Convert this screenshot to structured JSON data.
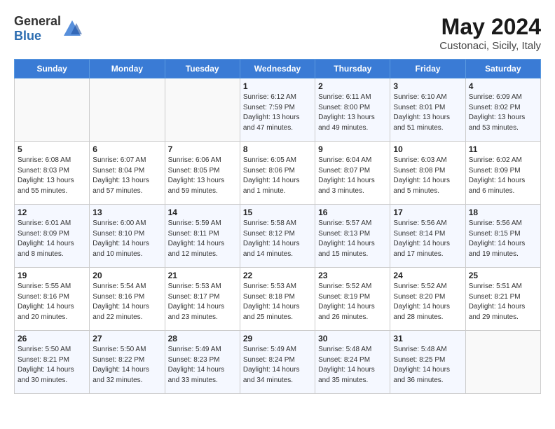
{
  "header": {
    "logo_general": "General",
    "logo_blue": "Blue",
    "month_year": "May 2024",
    "location": "Custonaci, Sicily, Italy"
  },
  "weekdays": [
    "Sunday",
    "Monday",
    "Tuesday",
    "Wednesday",
    "Thursday",
    "Friday",
    "Saturday"
  ],
  "weeks": [
    [
      {
        "day": "",
        "info": ""
      },
      {
        "day": "",
        "info": ""
      },
      {
        "day": "",
        "info": ""
      },
      {
        "day": "1",
        "info": "Sunrise: 6:12 AM\nSunset: 7:59 PM\nDaylight: 13 hours\nand 47 minutes."
      },
      {
        "day": "2",
        "info": "Sunrise: 6:11 AM\nSunset: 8:00 PM\nDaylight: 13 hours\nand 49 minutes."
      },
      {
        "day": "3",
        "info": "Sunrise: 6:10 AM\nSunset: 8:01 PM\nDaylight: 13 hours\nand 51 minutes."
      },
      {
        "day": "4",
        "info": "Sunrise: 6:09 AM\nSunset: 8:02 PM\nDaylight: 13 hours\nand 53 minutes."
      }
    ],
    [
      {
        "day": "5",
        "info": "Sunrise: 6:08 AM\nSunset: 8:03 PM\nDaylight: 13 hours\nand 55 minutes."
      },
      {
        "day": "6",
        "info": "Sunrise: 6:07 AM\nSunset: 8:04 PM\nDaylight: 13 hours\nand 57 minutes."
      },
      {
        "day": "7",
        "info": "Sunrise: 6:06 AM\nSunset: 8:05 PM\nDaylight: 13 hours\nand 59 minutes."
      },
      {
        "day": "8",
        "info": "Sunrise: 6:05 AM\nSunset: 8:06 PM\nDaylight: 14 hours\nand 1 minute."
      },
      {
        "day": "9",
        "info": "Sunrise: 6:04 AM\nSunset: 8:07 PM\nDaylight: 14 hours\nand 3 minutes."
      },
      {
        "day": "10",
        "info": "Sunrise: 6:03 AM\nSunset: 8:08 PM\nDaylight: 14 hours\nand 5 minutes."
      },
      {
        "day": "11",
        "info": "Sunrise: 6:02 AM\nSunset: 8:09 PM\nDaylight: 14 hours\nand 6 minutes."
      }
    ],
    [
      {
        "day": "12",
        "info": "Sunrise: 6:01 AM\nSunset: 8:09 PM\nDaylight: 14 hours\nand 8 minutes."
      },
      {
        "day": "13",
        "info": "Sunrise: 6:00 AM\nSunset: 8:10 PM\nDaylight: 14 hours\nand 10 minutes."
      },
      {
        "day": "14",
        "info": "Sunrise: 5:59 AM\nSunset: 8:11 PM\nDaylight: 14 hours\nand 12 minutes."
      },
      {
        "day": "15",
        "info": "Sunrise: 5:58 AM\nSunset: 8:12 PM\nDaylight: 14 hours\nand 14 minutes."
      },
      {
        "day": "16",
        "info": "Sunrise: 5:57 AM\nSunset: 8:13 PM\nDaylight: 14 hours\nand 15 minutes."
      },
      {
        "day": "17",
        "info": "Sunrise: 5:56 AM\nSunset: 8:14 PM\nDaylight: 14 hours\nand 17 minutes."
      },
      {
        "day": "18",
        "info": "Sunrise: 5:56 AM\nSunset: 8:15 PM\nDaylight: 14 hours\nand 19 minutes."
      }
    ],
    [
      {
        "day": "19",
        "info": "Sunrise: 5:55 AM\nSunset: 8:16 PM\nDaylight: 14 hours\nand 20 minutes."
      },
      {
        "day": "20",
        "info": "Sunrise: 5:54 AM\nSunset: 8:16 PM\nDaylight: 14 hours\nand 22 minutes."
      },
      {
        "day": "21",
        "info": "Sunrise: 5:53 AM\nSunset: 8:17 PM\nDaylight: 14 hours\nand 23 minutes."
      },
      {
        "day": "22",
        "info": "Sunrise: 5:53 AM\nSunset: 8:18 PM\nDaylight: 14 hours\nand 25 minutes."
      },
      {
        "day": "23",
        "info": "Sunrise: 5:52 AM\nSunset: 8:19 PM\nDaylight: 14 hours\nand 26 minutes."
      },
      {
        "day": "24",
        "info": "Sunrise: 5:52 AM\nSunset: 8:20 PM\nDaylight: 14 hours\nand 28 minutes."
      },
      {
        "day": "25",
        "info": "Sunrise: 5:51 AM\nSunset: 8:21 PM\nDaylight: 14 hours\nand 29 minutes."
      }
    ],
    [
      {
        "day": "26",
        "info": "Sunrise: 5:50 AM\nSunset: 8:21 PM\nDaylight: 14 hours\nand 30 minutes."
      },
      {
        "day": "27",
        "info": "Sunrise: 5:50 AM\nSunset: 8:22 PM\nDaylight: 14 hours\nand 32 minutes."
      },
      {
        "day": "28",
        "info": "Sunrise: 5:49 AM\nSunset: 8:23 PM\nDaylight: 14 hours\nand 33 minutes."
      },
      {
        "day": "29",
        "info": "Sunrise: 5:49 AM\nSunset: 8:24 PM\nDaylight: 14 hours\nand 34 minutes."
      },
      {
        "day": "30",
        "info": "Sunrise: 5:48 AM\nSunset: 8:24 PM\nDaylight: 14 hours\nand 35 minutes."
      },
      {
        "day": "31",
        "info": "Sunrise: 5:48 AM\nSunset: 8:25 PM\nDaylight: 14 hours\nand 36 minutes."
      },
      {
        "day": "",
        "info": ""
      }
    ]
  ]
}
